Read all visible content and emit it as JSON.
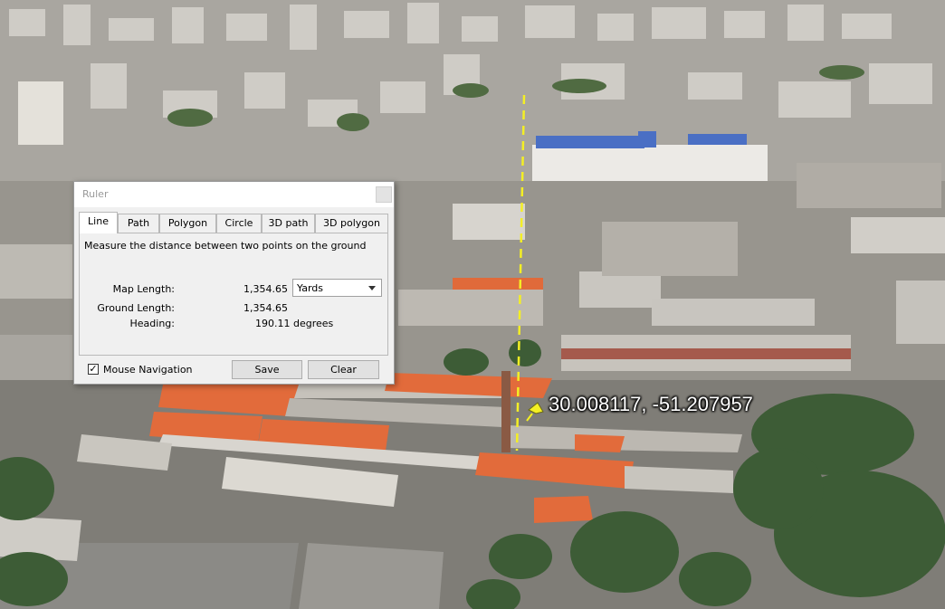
{
  "map": {
    "placemark_label": "30.008117, -51.207957",
    "colors": {
      "roof_orange": "#e06a3a",
      "tree_green": "#3f5e36",
      "ruler_line": "#f4ef24"
    }
  },
  "ruler": {
    "title": "Ruler",
    "tabs": [
      "Line",
      "Path",
      "Polygon",
      "Circle",
      "3D path",
      "3D polygon"
    ],
    "active_tab": "Line",
    "description": "Measure the distance between two points on the ground",
    "map_length_label": "Map Length:",
    "map_length_value": "1,354.65",
    "unit_selected": "Yards",
    "ground_length_label": "Ground Length:",
    "ground_length_value": "1,354.65",
    "heading_label": "Heading:",
    "heading_value": "190.11 degrees",
    "mouse_nav_label": "Mouse Navigation",
    "mouse_nav_checked": true,
    "save_label": "Save",
    "clear_label": "Clear"
  }
}
